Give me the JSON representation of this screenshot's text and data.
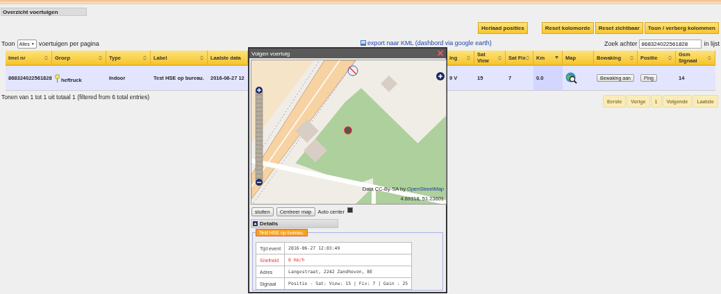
{
  "panel": {
    "title": "Overzicht voertuigen"
  },
  "toolbar": {
    "buttons": [
      "Herlaad posities",
      "Reset kolomorde",
      "Reset zichtbaar",
      "Toon / verberg kolommen"
    ]
  },
  "length_menu": {
    "before": "Toon",
    "value": "Alles",
    "caret": "▼",
    "after": "voertuigen per pagina"
  },
  "export_link": "export naar KML (dashbord via google earth)",
  "search": {
    "label": "Zoek achter",
    "value": "868324022561828",
    "after": "in lijst"
  },
  "table": {
    "columns": [
      {
        "label": "Imei nr",
        "sortable": true,
        "sorted": false
      },
      {
        "label": "Groep",
        "sortable": true,
        "sorted": false
      },
      {
        "label": "Type",
        "sortable": true,
        "sorted": false
      },
      {
        "label": "Label",
        "sortable": true,
        "sorted": false
      },
      {
        "label": "Laatste data",
        "sortable": false,
        "sorted": false
      },
      {
        "label": "ing",
        "sortable": true,
        "sorted": false
      },
      {
        "label": "Sat View",
        "sortable": true,
        "sorted": false
      },
      {
        "label": "Sat Fix",
        "sortable": true,
        "sorted": false
      },
      {
        "label": "Km",
        "sortable": true,
        "sorted": true
      },
      {
        "label": "Map",
        "sortable": false,
        "sorted": false
      },
      {
        "label": "Bewaking",
        "sortable": true,
        "sorted": false
      },
      {
        "label": "Positie",
        "sortable": true,
        "sorted": false
      },
      {
        "label": "Gsm Signaal",
        "sortable": true,
        "sorted": false
      }
    ],
    "rows": [
      {
        "selected": true,
        "cells": [
          {
            "kind": "text",
            "text": "868324022561828"
          },
          {
            "kind": "pin",
            "text": "heftruck"
          },
          {
            "kind": "text",
            "text": "Indoor"
          },
          {
            "kind": "text",
            "text": "Test HSE op bureau."
          },
          {
            "kind": "text",
            "text": "2016-06-27 12"
          },
          {
            "kind": "text",
            "text": "9 V"
          },
          {
            "kind": "text",
            "text": "15"
          },
          {
            "kind": "text",
            "text": "7"
          },
          {
            "kind": "text",
            "text": "0.0"
          },
          {
            "kind": "map"
          },
          {
            "kind": "button",
            "text": "Bewaking aan"
          },
          {
            "kind": "button",
            "text": "Ping"
          },
          {
            "kind": "text",
            "text": "14"
          }
        ]
      }
    ]
  },
  "info": "Tonen van 1 tot 1 uit totaal 1 (filtered from 6 total entries)",
  "pagination": [
    {
      "label": "Eerste",
      "disabled": true
    },
    {
      "label": "Vorige",
      "disabled": true
    },
    {
      "label": "1",
      "disabled": true
    },
    {
      "label": "Volgende",
      "disabled": true
    },
    {
      "label": "Laatste",
      "disabled": true
    }
  ],
  "dialog": {
    "title": "Volgen voertuig",
    "close": "✕",
    "map": {
      "attribution": "Data CC-By-SA by",
      "attribution_link": "OpenStreetMap",
      "coordinates": "4.69318, 51.23601"
    },
    "buttons": [
      "sluiten",
      "Centreer map"
    ],
    "auto_center": {
      "label": "Auto center",
      "checked": true
    },
    "details": {
      "title": "Details",
      "expanded": true,
      "legend": "Test HSE op bureau.",
      "rows": [
        {
          "label": "Tijd event",
          "value": "2016-06-27 12:03:49",
          "warning": false
        },
        {
          "label": "Snelheid",
          "value": "0 Km/h",
          "warning": true
        },
        {
          "label": "Adres",
          "value": "Langestraat, 2242 Zandhoven, BE",
          "warning": false
        },
        {
          "label": "Signaal",
          "value": "Positie - Sat: View: 15 | Fix: 7 | Gain : 25",
          "warning": false
        }
      ]
    }
  }
}
